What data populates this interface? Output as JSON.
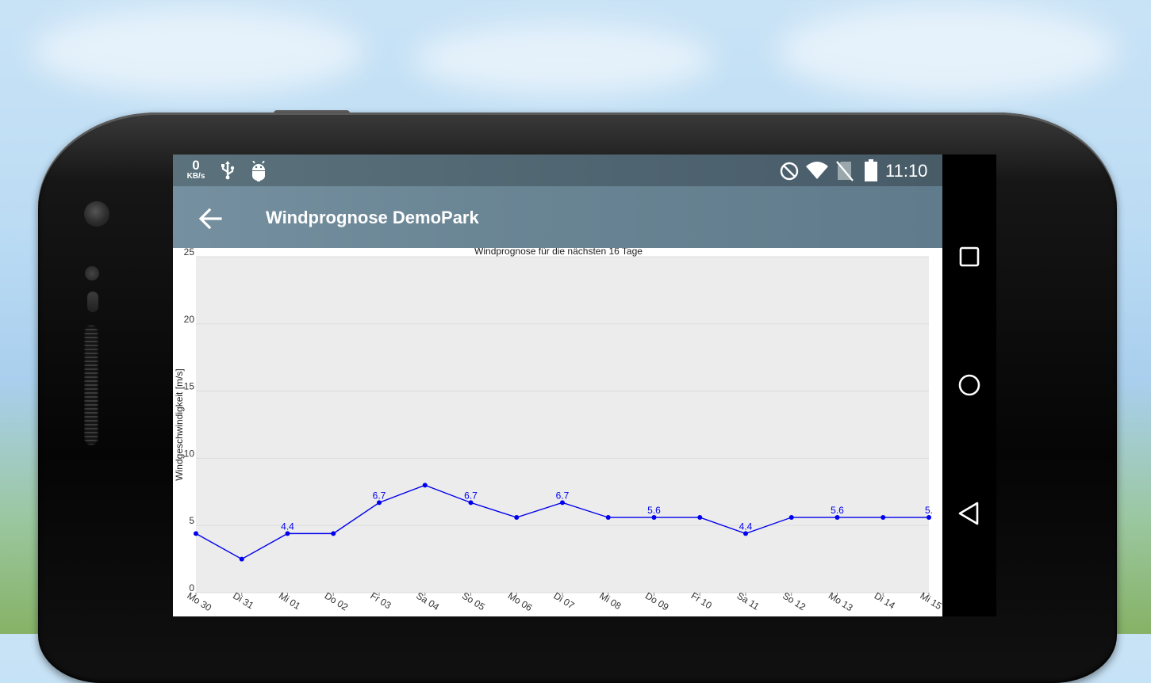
{
  "statusbar": {
    "net_speed_value": "0",
    "net_speed_unit": "KB/s",
    "time": "11:10",
    "icons": [
      "usb-icon",
      "android-debug-icon",
      "do-not-disturb-icon",
      "wifi-icon",
      "no-sim-icon",
      "battery-icon"
    ]
  },
  "appbar": {
    "title": "Windprognose DemoPark",
    "back_icon": "arrow-back-icon"
  },
  "navbar": {
    "icons": [
      "recent-apps-icon",
      "home-icon",
      "back-icon"
    ]
  },
  "zoom": {
    "icons": [
      "zoom-in-icon",
      "zoom-out-icon",
      "zoom-reset-icon"
    ]
  },
  "chart_data": {
    "type": "line",
    "title": "Windprognose für die nächsten 16 Tage",
    "ylabel": "Windgeschwindigkeit [m/s]",
    "xlabel": "",
    "ylim": [
      0,
      25
    ],
    "yticks": [
      0,
      5,
      10,
      15,
      20,
      25
    ],
    "grid": true,
    "line_color": "#0000ee",
    "plot_background": "#ececec",
    "categories": [
      "Mo 30",
      "Di 31",
      "Mi 01",
      "Do 02",
      "Fr 03",
      "Sa 04",
      "So 05",
      "Mo 06",
      "Di 07",
      "Mi 08",
      "Do 09",
      "Fr 10",
      "Sa 11",
      "So 12",
      "Mo 13",
      "Di 14",
      "Mi 15"
    ],
    "values": [
      4.4,
      2.5,
      4.4,
      4.4,
      6.7,
      8.0,
      6.7,
      5.6,
      6.7,
      5.6,
      5.6,
      5.6,
      4.4,
      5.6,
      5.6,
      5.6,
      5.6
    ],
    "data_labels": [
      {
        "index": 2,
        "text": "4.4"
      },
      {
        "index": 4,
        "text": "6.7"
      },
      {
        "index": 6,
        "text": "6.7"
      },
      {
        "index": 8,
        "text": "6.7"
      },
      {
        "index": 10,
        "text": "5.6"
      },
      {
        "index": 12,
        "text": "4.4"
      },
      {
        "index": 14,
        "text": "5.6"
      },
      {
        "index": 16,
        "text": "5."
      }
    ]
  }
}
